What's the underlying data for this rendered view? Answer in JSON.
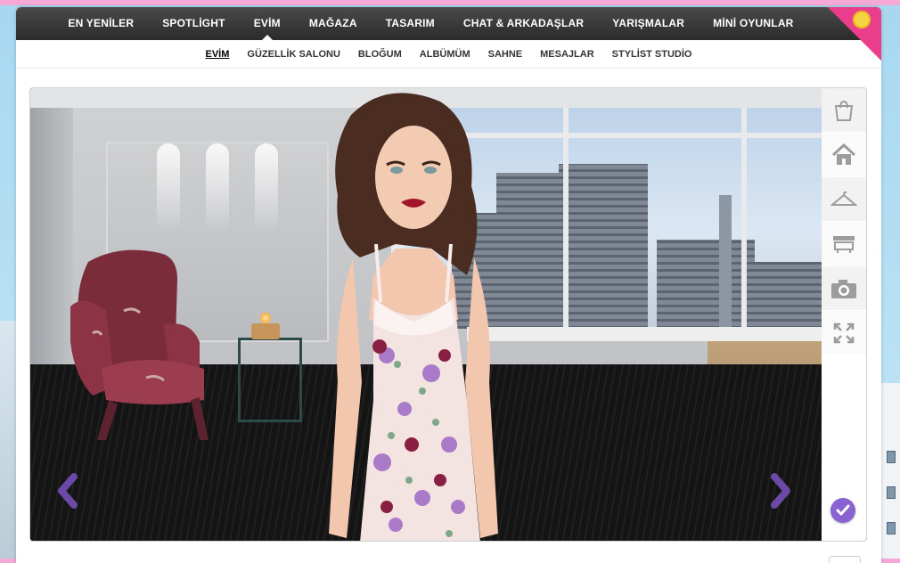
{
  "top_nav": {
    "items": [
      {
        "label": "EN YENİLER"
      },
      {
        "label": "SPOTLİGHT"
      },
      {
        "label": "EVİM"
      },
      {
        "label": "MAĞAZA"
      },
      {
        "label": "TASARIM"
      },
      {
        "label": "CHAT & ARKADAŞLAR"
      },
      {
        "label": "YARIŞMALAR"
      },
      {
        "label": "MİNİ OYUNLAR"
      }
    ],
    "active_index": 2
  },
  "sub_nav": {
    "items": [
      {
        "label": "EVİM"
      },
      {
        "label": "GÜZELLİK SALONU"
      },
      {
        "label": "BLOĞUM"
      },
      {
        "label": "ALBÜMÜM"
      },
      {
        "label": "SAHNE"
      },
      {
        "label": "MESAJLAR"
      },
      {
        "label": "STYLİST STUDİO"
      }
    ],
    "active_index": 0
  },
  "toolbar": {
    "tools": [
      {
        "icon": "shopping-bag-icon"
      },
      {
        "icon": "home-icon"
      },
      {
        "icon": "hanger-icon"
      },
      {
        "icon": "furniture-icon"
      },
      {
        "icon": "camera-icon"
      },
      {
        "icon": "fullscreen-icon"
      }
    ],
    "confirm_icon": "checkmark-icon"
  },
  "navigation": {
    "prev_icon": "chevron-left-icon",
    "next_icon": "chevron-right-icon"
  },
  "colors": {
    "nav_bg": "#2b2b2b",
    "accent_pink": "#e83e8c",
    "accent_purple": "#8a63d2",
    "arrow_purple": "#6a4aa6"
  }
}
